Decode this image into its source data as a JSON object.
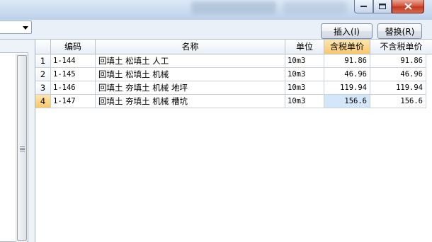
{
  "window": {
    "minimize_icon": "minimize-icon",
    "maximize_icon": "maximize-icon",
    "close_icon": "close-icon"
  },
  "toolbar": {
    "insert_label": "插入(I)",
    "replace_label": "替换(R)"
  },
  "table": {
    "headers": [
      "",
      "编码",
      "名称",
      "单位",
      "含税单价",
      "不含税单价"
    ],
    "rows": [
      {
        "num": "1",
        "code": "1-144",
        "name": "回填土 松填土 人工",
        "unit": "10m3",
        "tax_price": "91.86",
        "notax_price": "91.86"
      },
      {
        "num": "2",
        "code": "1-145",
        "name": "回填土 松填土 机械",
        "unit": "10m3",
        "tax_price": "46.96",
        "notax_price": "46.96"
      },
      {
        "num": "3",
        "code": "1-146",
        "name": "回填土 夯填土 机械 地坪",
        "unit": "10m3",
        "tax_price": "119.94",
        "notax_price": "119.94"
      },
      {
        "num": "4",
        "code": "1-147",
        "name": "回填土 夯填土 机械 槽坑",
        "unit": "10m3",
        "tax_price": "156.6",
        "notax_price": "156.6"
      }
    ]
  },
  "colors": {
    "active_header": "#f8c86b",
    "selected_cell": "#d4e6fa",
    "close_button": "#c23a22"
  }
}
